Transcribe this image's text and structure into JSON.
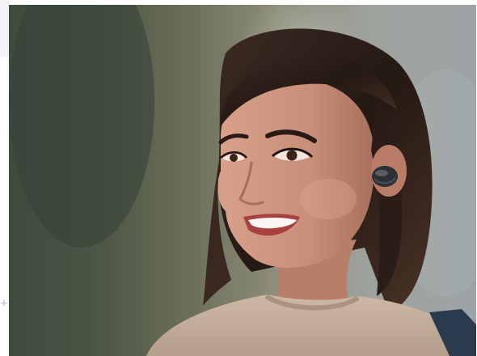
{
  "viewer": {
    "scroll_glyph": "+",
    "photo_subject": "woman-wearing-wireless-earbud",
    "icons": [
      "plus-icon"
    ]
  },
  "colors": {
    "background_left": "#434f40",
    "background_right": "#9fa4a6",
    "hair": "#2a1d18",
    "skin": "#c8907a",
    "sweater": "#c7b3a0",
    "earbud": "#2d3034",
    "strap": "#2b3a4d"
  }
}
